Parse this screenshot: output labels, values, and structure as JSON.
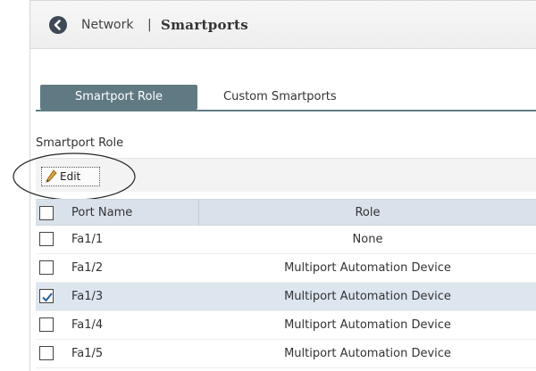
{
  "breadcrumb": {
    "parent": "Network",
    "separator": "|",
    "current": "Smartports"
  },
  "tabs": [
    {
      "label": "Smartport Role",
      "active": true
    },
    {
      "label": "Custom Smartports",
      "active": false
    }
  ],
  "section": {
    "title": "Smartport Role"
  },
  "toolbar": {
    "edit_label": "Edit"
  },
  "grid": {
    "columns": [
      "Port Name",
      "Role"
    ],
    "rows": [
      {
        "port": "Fa1/1",
        "role": "None",
        "checked": false
      },
      {
        "port": "Fa1/2",
        "role": "Multiport Automation Device",
        "checked": false
      },
      {
        "port": "Fa1/3",
        "role": "Multiport Automation Device",
        "checked": true
      },
      {
        "port": "Fa1/4",
        "role": "Multiport Automation Device",
        "checked": false
      },
      {
        "port": "Fa1/5",
        "role": "Multiport Automation Device",
        "checked": false
      }
    ]
  },
  "colors": {
    "active_tab": "#5f7a82",
    "header_row": "#d9e2ea",
    "selected_row": "#dde6ef",
    "back_button": "#3e4a57"
  },
  "icons": {
    "back": "back-arrow-icon",
    "edit": "pencil-icon",
    "check": "check-icon"
  }
}
